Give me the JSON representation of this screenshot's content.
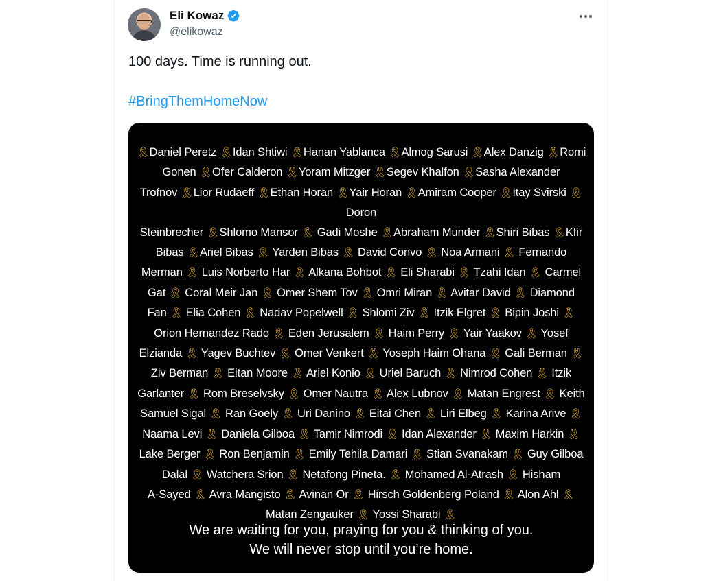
{
  "author": {
    "name": "Eli Kowaz",
    "handle": "@elikowaz",
    "verified": true,
    "avatar_icon": "profile-photo"
  },
  "post": {
    "text": "100 days. Time is running out.",
    "hashtag": "#BringThemHomeNow"
  },
  "image": {
    "ribbon_icon": "yellow-ribbon-icon",
    "lines": [
      "🎗Daniel Peretz 🎗Idan Shtiwi 🎗Hanan Yablanca 🎗Almog Sarusi 🎗Alex Danzig 🎗Romi",
      "Gonen 🎗Ofer Calderon 🎗Yoram Mitzger 🎗Segev Khalfon 🎗Sasha Alexander",
      "Trofnov 🎗Lior Rudaeff 🎗Ethan Horan 🎗Yair Horan 🎗Amiram Cooper 🎗Itay Svirski 🎗Doron",
      "Steinbrecher 🎗Shlomo Mansor 🎗 Gadi Moshe 🎗Abraham Munder 🎗Shiri Bibas 🎗Kfir",
      "Bibas 🎗Ariel Bibas 🎗 Yarden Bibas 🎗 David Convo 🎗 Noa Armani 🎗 Fernando",
      "Merman 🎗 Luis Norberto Har 🎗 Alkana Bohbot 🎗 Eli Sharabi 🎗 Tzahi Idan 🎗 Carmel",
      "Gat 🎗 Coral Meir Jan 🎗 Omer Shem Tov 🎗 Omri Miran 🎗 Avitar David 🎗 Diamond",
      "Fan 🎗 Elia Cohen 🎗 Nadav Popelwell 🎗 Shlomi Ziv 🎗 Itzik Elgret 🎗 Bipin Joshi 🎗",
      "Orion Hernandez Rado 🎗 Eden Jerusalem 🎗 Haim Perry 🎗 Yair Yaakov 🎗 Yosef",
      "Elzianda 🎗 Yagev Buchtev 🎗 Omer Venkert 🎗 Yoseph Haim Ohana 🎗 Gali Berman 🎗",
      "Ziv Berman 🎗 Eitan Moore 🎗 Ariel Konio 🎗 Uriel Baruch 🎗 Nimrod Cohen 🎗 Itzik",
      "Garlanter 🎗 Rom Breselvsky 🎗 Omer Nautra 🎗 Alex Lubnov 🎗 Matan Engrest 🎗 Keith",
      "Samuel Sigal 🎗 Ran Goely 🎗 Uri Danino 🎗 Eitai Chen 🎗 Liri Elbeg 🎗 Karina Arive 🎗",
      "Naama Levi 🎗 Daniela Gilboa 🎗 Tamir Nimrodi 🎗 Idan Alexander 🎗 Maxim Harkin 🎗",
      "Lake Berger 🎗 Ron Benjamin 🎗 Emily Tehila Damari 🎗 Stian Svanakam 🎗 Guy Gilboa",
      "Dalal 🎗 Watchera Srion 🎗 Netafong Pineta. 🎗 Mohamed Al-Atrash 🎗 Hisham",
      "A-Sayed 🎗 Avra Mangisto 🎗 Avinan Or 🎗 Hirsch Goldenberg Poland 🎗 Alon Ahl 🎗",
      "Matan Zengauker 🎗 Yossi Sharabi 🎗"
    ],
    "message_line1": "We are waiting for you, praying for you & thinking of you.",
    "message_line2": "We will never stop until you’re home."
  },
  "colors": {
    "text": "#0f1419",
    "secondary": "#536471",
    "link": "#1d9bf0",
    "verified": "#1d9bf0",
    "ribbon": "#d9a63a",
    "media_bg": "#000000"
  }
}
